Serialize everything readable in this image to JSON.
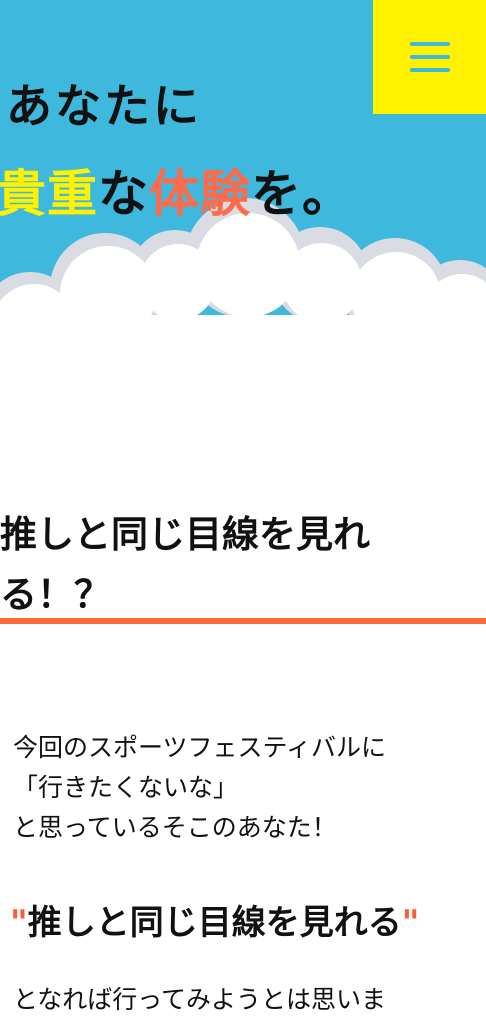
{
  "header": {
    "menu_icon": "hamburger-menu-icon",
    "line1": "あなたに",
    "line2_part1": "貴重",
    "line2_part2": "な",
    "line2_part3": "体験",
    "line2_part4": "を。"
  },
  "colors": {
    "sky": "#3fb8dd",
    "menu_bg": "#fff200",
    "highlight_yellow": "#fff200",
    "highlight_orange": "#ff6a4a",
    "rule_orange": "#ff6a3d"
  },
  "section": {
    "title_line1": "推しと同じ目線を見れ",
    "title_line2": "る！？",
    "paragraph_line1": "今回のスポーツフェスティバルに",
    "paragraph_line2": "「行きたくないな」",
    "paragraph_line3": "と思っているそこのあなた！",
    "quote_open": "\"",
    "quote_text": "推しと同じ目線を見れる",
    "quote_close": "\"",
    "paragraph_cont": "となれば行ってみようとは思いま"
  }
}
